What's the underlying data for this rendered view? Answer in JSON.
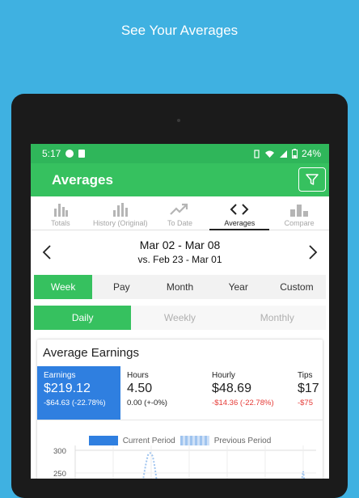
{
  "promo": {
    "title": "See Your Averages"
  },
  "status": {
    "time": "5:17",
    "battery": "24%"
  },
  "appbar": {
    "title": "Averages"
  },
  "tabs": [
    {
      "label": "Totals"
    },
    {
      "label": "History (Original)"
    },
    {
      "label": "To Date"
    },
    {
      "label": "Averages"
    },
    {
      "label": "Compare"
    }
  ],
  "period": {
    "range": "Mar 02 - Mar 08",
    "compare": "vs. Feb 23 - Mar 01"
  },
  "range_options": [
    "Week",
    "Pay",
    "Month",
    "Year",
    "Custom"
  ],
  "range_selected": "Week",
  "interval_options": [
    "Daily",
    "Weekly",
    "Monthly"
  ],
  "interval_selected": "Daily",
  "card": {
    "title": "Average Earnings",
    "metrics": [
      {
        "label": "Earnings",
        "value": "$219.12",
        "change": "-$64.63 (-22.78%)"
      },
      {
        "label": "Hours",
        "value": "4.50",
        "change": "0.00 (+-0%)"
      },
      {
        "label": "Hourly",
        "value": "$48.69",
        "change": "-$14.36 (-22.78%)"
      },
      {
        "label": "Tips",
        "value": "$17",
        "change": "-$75"
      }
    ],
    "legend": {
      "current": "Current Period",
      "previous": "Previous Period"
    },
    "axis": {
      "y_top": "300",
      "y_next": "250"
    }
  },
  "colors": {
    "green": "#36c15f",
    "blue": "#2f7fe0",
    "sky": "#3fb1e1",
    "negative": "#e53935"
  }
}
